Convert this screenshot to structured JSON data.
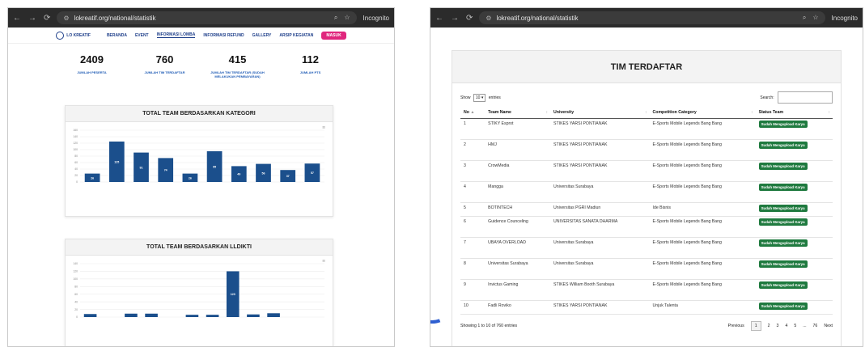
{
  "left_window": {
    "url": "lokreatif.org/national/statistik",
    "incognito": "Incognito",
    "site_nav": {
      "logo_text": "LO KREATIF",
      "items": [
        "BERANDA",
        "EVENT",
        "INFORMASI LOMBA",
        "INFORMASI REFUND",
        "GALLERY",
        "ARSIP KEGIATAN"
      ],
      "active_item": "INFORMASI LOMBA",
      "login_button": "MASUK"
    },
    "stats": [
      {
        "value": "2409",
        "label": "JUMLAH PESERTA"
      },
      {
        "value": "760",
        "label": "JUMLAH TIM TERDAFTAR"
      },
      {
        "value": "415",
        "label": "JUMLAH TIM TERDAFTAR (SUDAH MELAKUKAN PEMBAYARAN)"
      },
      {
        "value": "112",
        "label": "JUMLAH PTS"
      }
    ],
    "colors": {
      "accent": "#1e3f8a",
      "bar": "#1b4f8c",
      "login": "#e0267d"
    }
  },
  "right_window": {
    "url": "lokreatif.org/national/statistik",
    "incognito": "Incognito",
    "title": "TIM TERDAFTAR",
    "show_label": "Show",
    "entries_value": "10",
    "entries_label": "entries",
    "search_label": "Search:",
    "columns": [
      "No",
      "Team Name",
      "University",
      "Competition Category",
      "Status Team"
    ],
    "rows": [
      [
        "1",
        "STIKY Esprot",
        "STIKES YARSI PONTIANAK",
        "E-Sports Mobile Legends Bang Bang",
        "Sudah Mengupload Karya"
      ],
      [
        "2",
        "HMJ",
        "STIKES YARSI PONTIANAK",
        "E-Sports Mobile Legends Bang Bang",
        "Sudah Mengupload Karya"
      ],
      [
        "3",
        "CrowMedia",
        "STIKES YARSI PONTIANAK",
        "E-Sports Mobile Legends Bang Bang",
        "Sudah Mengupload Karya"
      ],
      [
        "4",
        "Mangga",
        "Universitas Surabaya",
        "E-Sports Mobile Legends Bang Bang",
        "Sudah Mengupload Karya"
      ],
      [
        "5",
        "BOTINTECH",
        "Universitas PGRI Madiun",
        "Ide Bisnis",
        "Sudah Mengupload Karya"
      ],
      [
        "6",
        "Guidence Counceling",
        "UNIVERSITAS SANATA DHARMA",
        "E-Sports Mobile Legends Bang Bang",
        "Sudah Mengupload Karya"
      ],
      [
        "7",
        "UBAYA OVERLOAD",
        "Universitas Surabaya",
        "E-Sports Mobile Legends Bang Bang",
        "Sudah Mengupload Karya"
      ],
      [
        "8",
        "Universitas Surabaya",
        "Universitas Surabaya",
        "E-Sports Mobile Legends Bang Bang",
        "Sudah Mengupload Karya"
      ],
      [
        "9",
        "Invictus Gaming",
        "STIKES William Booth Surabaya",
        "E-Sports Mobile Legends Bang Bang",
        "Sudah Mengupload Karya"
      ],
      [
        "10",
        "Fadli Roviko",
        "STIKES YARSI PONTIANAK",
        "Unjuk Talenta",
        "Sudah Mengupload Karya"
      ]
    ],
    "info": "Showing 1 to 10 of 760 entries",
    "pagination": [
      "Previous",
      "1",
      "2",
      "3",
      "4",
      "5",
      "...",
      "76",
      "Next"
    ],
    "badge_color": "#1f7a3f"
  },
  "chart_data": [
    {
      "type": "bar",
      "title": "TOTAL TEAM BERDASARKAN KATEGORI",
      "values": [
        26,
        125,
        91,
        74,
        26,
        95,
        49,
        56,
        37,
        57
      ],
      "data_labels": [
        "26",
        "125",
        "91",
        "74",
        "26",
        "95",
        "49",
        "56",
        "37",
        "57"
      ],
      "ylim": [
        0,
        160
      ],
      "yticks": [
        0,
        20,
        40,
        60,
        80,
        100,
        120,
        140,
        160
      ],
      "grid": true,
      "legend": "none"
    },
    {
      "type": "bar",
      "title": "TOTAL TEAM BERDASARKAN LLDIKTI",
      "values": [
        8,
        0,
        9,
        9,
        0,
        6,
        6,
        120,
        7,
        10,
        0,
        0
      ],
      "data_labels": [
        "",
        "",
        "",
        "",
        "",
        "",
        "",
        "120",
        "",
        "",
        "",
        ""
      ],
      "ylim": [
        0,
        140
      ],
      "yticks": [
        0,
        20,
        40,
        60,
        80,
        100,
        120,
        140
      ],
      "grid": true,
      "legend": "none"
    }
  ]
}
